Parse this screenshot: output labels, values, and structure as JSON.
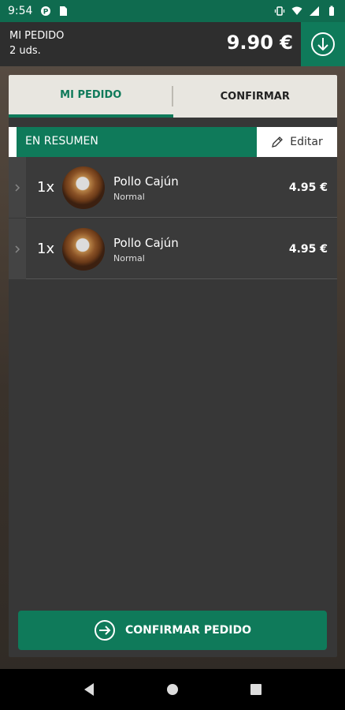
{
  "status_bar": {
    "time": "9:54",
    "left_icons": [
      "notification-icon",
      "sim-card-icon"
    ],
    "right_icons": [
      "vibrate-icon",
      "wifi-icon",
      "signal-icon",
      "battery-icon"
    ]
  },
  "order_bar": {
    "title": "MI PEDIDO",
    "units": "2 uds.",
    "total": "9.90 €",
    "download_icon": "arrow-down-circle-icon"
  },
  "tabs": [
    {
      "label": "MI PEDIDO",
      "active": true
    },
    {
      "label": "CONFIRMAR",
      "active": false
    }
  ],
  "summary": {
    "label": "EN RESUMEN",
    "edit_label": "Editar"
  },
  "items": [
    {
      "qty": "1x",
      "name": "Pollo Cajún",
      "variant": "Normal",
      "price": "4.95 €"
    },
    {
      "qty": "1x",
      "name": "Pollo Cajún",
      "variant": "Normal",
      "price": "4.95 €"
    }
  ],
  "confirm_button": {
    "label": "CONFIRMAR PEDIDO"
  },
  "colors": {
    "brand_green": "#0f7a5a",
    "status_green": "#0f6b4f",
    "panel": "#373737"
  }
}
